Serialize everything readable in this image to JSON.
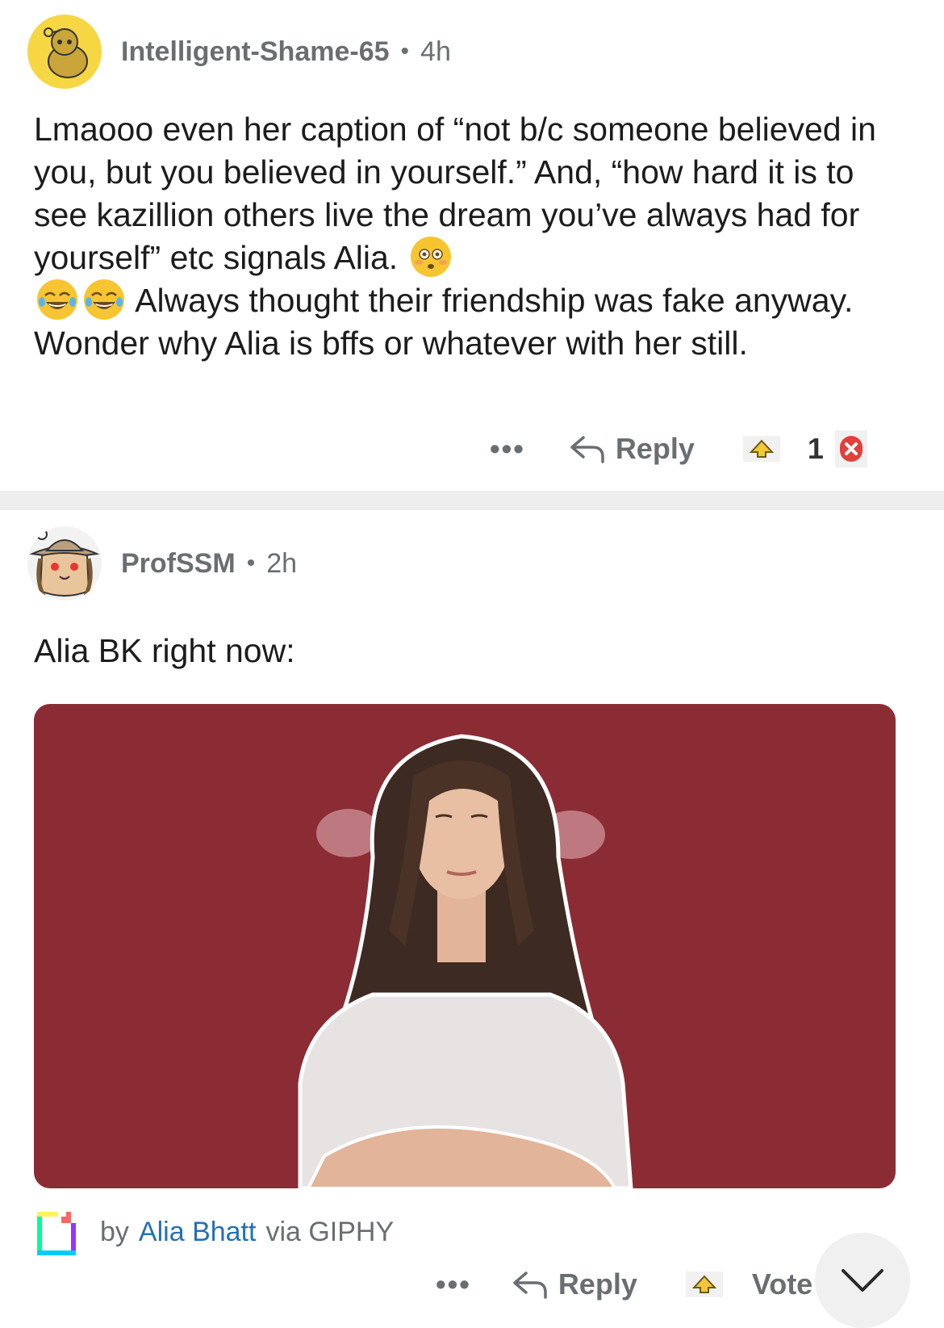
{
  "comments": [
    {
      "username": "Intelligent-Shame-65",
      "time": "4h",
      "text_parts": [
        "Lmaooo even her caption of “not b/c someone believed in you, but you believed in yourself.” And, “how hard it is to see kazillion others live the dream you’ve always had for yourself” etc signals Alia. ",
        " Always thought their friendship was fake anyway. Wonder why Alia is bffs or whatever with her still."
      ],
      "actions": {
        "more": "•••",
        "reply": "Reply",
        "vote_count": "1"
      }
    },
    {
      "username": "ProfSSM",
      "time": "2h",
      "text": "Alia BK right now:",
      "gif_attribution": {
        "by": "by",
        "author": "Alia Bhatt",
        "via": "via GIPHY"
      },
      "actions": {
        "more": "•••",
        "reply": "Reply",
        "vote": "Vote"
      }
    }
  ],
  "separator": "•",
  "colors": {
    "gif_background": "#8b2c35",
    "link": "#2570b4",
    "meta": "#6b6e70",
    "downvote": "#e0413a"
  },
  "icons": [
    "reddit-snoo-avatar",
    "cowboy-avatar",
    "flushed-emoji",
    "laughing-emoji",
    "reply-arrow-icon",
    "upvote-icon",
    "downvote-icon",
    "giphy-logo",
    "chevron-down-icon"
  ]
}
